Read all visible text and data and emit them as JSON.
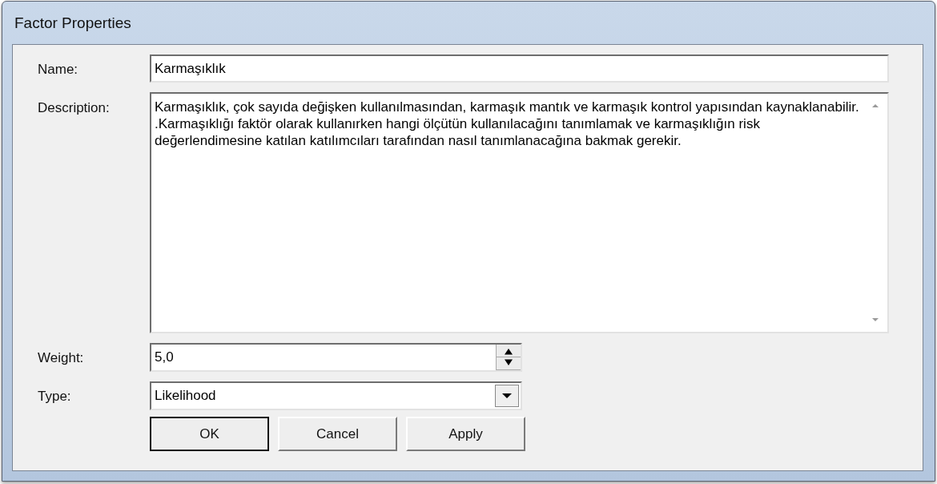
{
  "window": {
    "title": "Factor Properties"
  },
  "fields": {
    "name": {
      "label": "Name:",
      "value": "Karmaşıklık"
    },
    "description": {
      "label": "Description:",
      "value": "Karmaşıklık, çok sayıda değişken kullanılmasından, karmaşık mantık ve karmaşık kontrol yapısından kaynaklanabilir. .Karmaşıklığı faktör olarak kullanırken hangi ölçütün kullanılacağını tanımlamak ve karmaşıklığın risk değerlendimesine katılan katılımcıları tarafından nasıl tanımlanacağına bakmak gerekir."
    },
    "weight": {
      "label": "Weight:",
      "value": "5,0"
    },
    "type": {
      "label": "Type:",
      "value": "Likelihood"
    }
  },
  "buttons": [
    {
      "label": "OK",
      "default": true
    },
    {
      "label": "Cancel",
      "default": false
    },
    {
      "label": "Apply",
      "default": false
    }
  ]
}
